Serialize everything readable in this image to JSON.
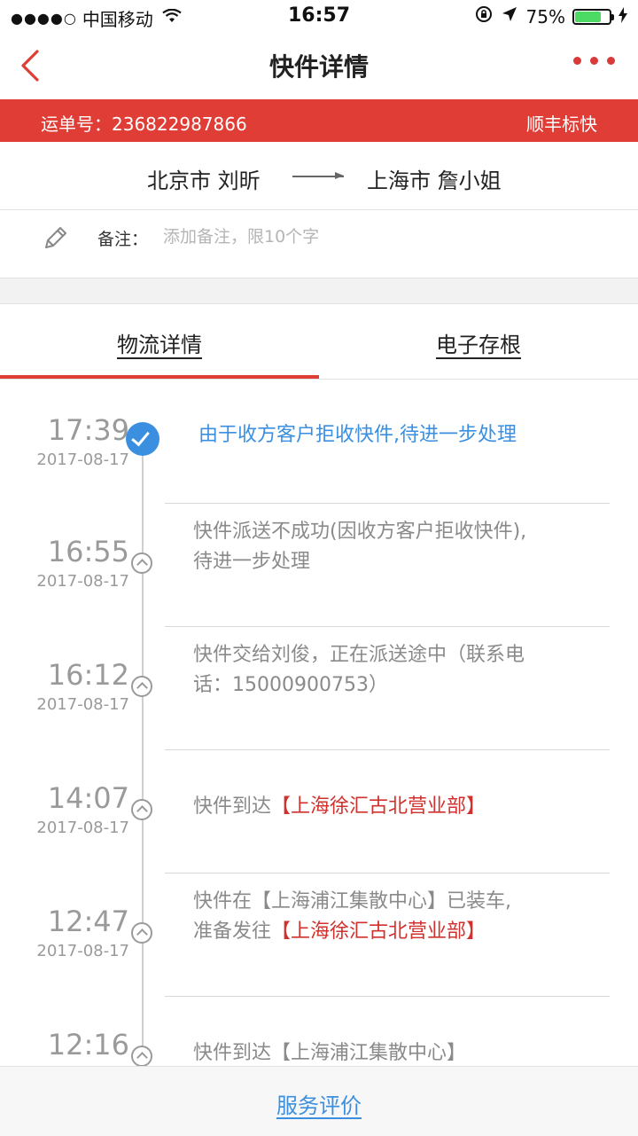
{
  "status_bar": {
    "signal": "●●●●○",
    "carrier": "中国移动",
    "wifi_icon": "wifi-icon",
    "time": "16:57",
    "lock_icon": "orientation-lock-icon",
    "location_icon": "location-arrow-icon",
    "battery_percent": "75%",
    "battery_level": 0.75,
    "battery_color": "#4cd964"
  },
  "nav": {
    "back_icon": "chevron-left-icon",
    "title": "快件详情",
    "more_icon": "more-dots-icon"
  },
  "waybill": {
    "number_text": "运单号：236822987866",
    "service": "顺丰标快",
    "bg_color": "#e03d36"
  },
  "route": {
    "from": "北京市 刘昕",
    "to": "上海市 詹小姐"
  },
  "remark": {
    "label": "备注：",
    "placeholder": "添加备注，限10个字",
    "value": ""
  },
  "tabs": [
    {
      "label": "物流详情",
      "active": true
    },
    {
      "label": "电子存根",
      "active": false
    }
  ],
  "events": [
    {
      "time": "17:39",
      "date": "2017-08-17",
      "lines": [
        "由于收方客户拒收快件,待进一步处理"
      ],
      "status": "done"
    },
    {
      "time": "16:55",
      "date": "2017-08-17",
      "lines": [
        "快件派送不成功(因收方客户拒收快件),",
        "待进一步处理"
      ],
      "status": "past"
    },
    {
      "time": "16:12",
      "date": "2017-08-17",
      "lines": [
        "快件交给刘俊，正在派送途中（联系电",
        "话：15000900753）"
      ],
      "status": "past"
    },
    {
      "time": "14:07",
      "date": "2017-08-17",
      "line1_prefix": "快件到达",
      "line1_highlight": "【上海徐汇古北营业部】",
      "status": "past"
    },
    {
      "time": "12:47",
      "date": "2017-08-17",
      "line1": "快件在【上海浦江集散中心】已装车,",
      "line2_prefix": "准备发往",
      "line2_highlight": "【上海徐汇古北营业部】",
      "status": "past"
    },
    {
      "time": "12:16",
      "date": "",
      "lines": [
        "快件到达【上海浦江集散中心】"
      ],
      "status": "past"
    }
  ],
  "bottom": {
    "button": "服务评价"
  },
  "colors": {
    "accent_red": "#e03d36",
    "highlight_red": "#d0312d",
    "link_blue": "#3b8fe0"
  }
}
